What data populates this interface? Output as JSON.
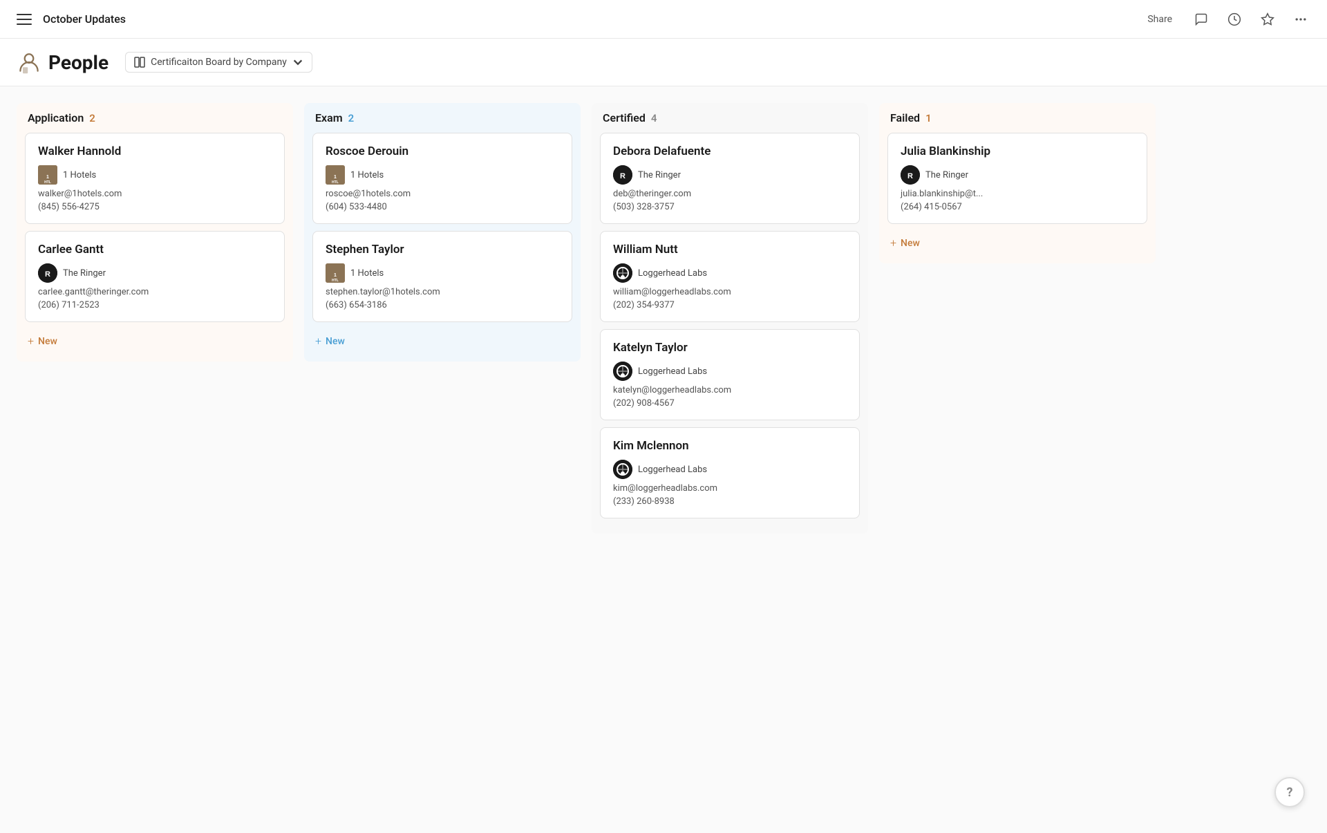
{
  "topbar": {
    "title": "October Updates",
    "share_label": "Share",
    "more_label": "..."
  },
  "subheader": {
    "people_label": "People",
    "view_label": "Certificaiton Board by Company"
  },
  "board": {
    "columns": [
      {
        "id": "application",
        "title": "Application",
        "count": "2",
        "count_class": "count-orange",
        "bg_class": "col-application",
        "new_label": "New",
        "new_class": "",
        "cards": [
          {
            "name": "Walker Hannold",
            "company": "1 Hotels",
            "company_logo": "1hotels",
            "email": "walker@1hotels.com",
            "phone": "(845) 556-4275"
          },
          {
            "name": "Carlee Gantt",
            "company": "The Ringer",
            "company_logo": "ringer",
            "email": "carlee.gantt@theringer.com",
            "phone": "(206) 711-2523"
          }
        ]
      },
      {
        "id": "exam",
        "title": "Exam",
        "count": "2",
        "count_class": "count-blue",
        "bg_class": "col-exam",
        "new_label": "New",
        "new_class": "new-btn-blue",
        "cards": [
          {
            "name": "Roscoe Derouin",
            "company": "1 Hotels",
            "company_logo": "1hotels",
            "email": "roscoe@1hotels.com",
            "phone": "(604) 533-4480"
          },
          {
            "name": "Stephen Taylor",
            "company": "1 Hotels",
            "company_logo": "1hotels",
            "email": "stephen.taylor@1hotels.com",
            "phone": "(663) 654-3186"
          }
        ]
      },
      {
        "id": "certified",
        "title": "Certified",
        "count": "4",
        "count_class": "count-gray",
        "bg_class": "col-certified",
        "new_label": null,
        "cards": [
          {
            "name": "Debora Delafuente",
            "company": "The Ringer",
            "company_logo": "ringer",
            "email": "deb@theringer.com",
            "phone": "(503) 328-3757"
          },
          {
            "name": "William Nutt",
            "company": "Loggerhead Labs",
            "company_logo": "loggerhead",
            "email": "william@loggerheadlabs.com",
            "phone": "(202) 354-9377"
          },
          {
            "name": "Katelyn Taylor",
            "company": "Loggerhead Labs",
            "company_logo": "loggerhead",
            "email": "katelyn@loggerheadlabs.com",
            "phone": "(202) 908-4567"
          },
          {
            "name": "Kim Mclennon",
            "company": "Loggerhead Labs",
            "company_logo": "loggerhead",
            "email": "kim@loggerheadlabs.com",
            "phone": "(233) 260-8938"
          }
        ]
      },
      {
        "id": "failed",
        "title": "Failed",
        "count": "1",
        "count_class": "count-orange",
        "bg_class": "col-failed",
        "new_label": "New",
        "new_class": "",
        "cards": [
          {
            "name": "Julia Blankinship",
            "company": "The Ringer",
            "company_logo": "ringer",
            "email": "julia.blankinship@t...",
            "phone": "(264) 415-0567"
          }
        ]
      }
    ]
  },
  "help_label": "?"
}
